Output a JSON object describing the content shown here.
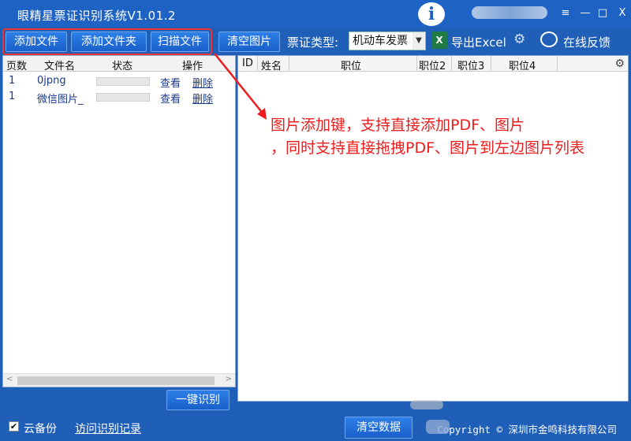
{
  "window": {
    "title": "眼精星票证识别系统V1.01.2",
    "logo_text": "i",
    "controls": {
      "menu": "≡",
      "minimize": "—",
      "maximize": "□",
      "close": "X"
    }
  },
  "toolbar": {
    "add_file": "添加文件",
    "add_folder": "添加文件夹",
    "scan_file": "扫描文件",
    "clear_images": "清空图片",
    "ticket_type_label": "票证类型:",
    "ticket_type_value": "机动车发票",
    "export_excel": "导出Excel",
    "feedback": "在线反馈"
  },
  "file_table": {
    "columns": [
      "页数",
      "文件名",
      "状态",
      "操作"
    ],
    "rows": [
      {
        "page": "1",
        "filename": "0jpng",
        "view": "查看",
        "delete": "删除"
      },
      {
        "page": "1",
        "filename": "微信图片_",
        "view": "查看",
        "delete": "删除"
      }
    ]
  },
  "result_table": {
    "columns": [
      "ID",
      "姓名",
      "职位",
      "职位2",
      "职位3",
      "职位4"
    ]
  },
  "annotation": {
    "line1": "图片添加键，支持直接添加PDF、图片",
    "line2": "，同时支持直接拖拽PDF、图片到左边图片列表",
    "color": "#ee1c1c"
  },
  "actions": {
    "recognize": "一键识别",
    "clear_data": "清空数据"
  },
  "statusbar": {
    "cloud_backup": "云备份",
    "cloud_backup_checked": "✔",
    "visit_records": "访问识别记录",
    "copyright": "Copyright © 深圳市金鸣科技有限公司"
  },
  "colors": {
    "primary": "#1f5fb8",
    "button": "#2d7fe8",
    "highlight": "#e33333"
  }
}
